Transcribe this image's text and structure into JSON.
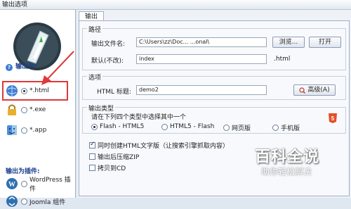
{
  "window": {
    "title": "输出选项"
  },
  "sidebar": {
    "output_as_label": "输出为:",
    "output_items": [
      {
        "label": "*.html",
        "selected": true
      },
      {
        "label": "*.exe",
        "selected": false
      },
      {
        "label": "*.app",
        "selected": false
      }
    ],
    "plugin_label": "输出为插件:",
    "plugin_items": [
      {
        "label": "WordPress 插件",
        "selected": false
      },
      {
        "label": "Joomla 组件",
        "selected": false
      }
    ]
  },
  "tab": {
    "label": "输出"
  },
  "path_group": {
    "title": "路径",
    "output_file_label": "输出文件名:",
    "output_file_value": "C:\\Users\\zz\\Doc...        ...onal\\",
    "browse_label": "浏览...",
    "open_label": "打开",
    "default_label": "默认(不改):",
    "default_value": "index",
    "extension": ".html"
  },
  "options_group": {
    "title": "选项",
    "html_title_label": "HTML 标题:",
    "html_title_value": "demo2",
    "advanced_label": "高级(A)"
  },
  "output_type_group": {
    "title": "输出类型",
    "instruction": "请在下列四个类型中选择其中一个",
    "types": [
      {
        "label": "Flash - HTML5",
        "selected": true
      },
      {
        "label": "HTML5 - Flash",
        "selected": false
      },
      {
        "label": "网页版",
        "selected": false
      },
      {
        "label": "手机版",
        "selected": false
      }
    ]
  },
  "checkboxes": [
    {
      "label": "同时创建HTML文字版（让搜索引擎抓取内容）",
      "checked": true
    },
    {
      "label": "输出后压缩ZIP",
      "checked": false
    },
    {
      "label": "拷贝到CD",
      "checked": false
    }
  ],
  "watermark": {
    "main": "百科全说",
    "sub": "助你轻松解决"
  },
  "colors": {
    "highlight": "#e0383a",
    "accent": "#3a7bd5",
    "html5": "#e44d26"
  }
}
